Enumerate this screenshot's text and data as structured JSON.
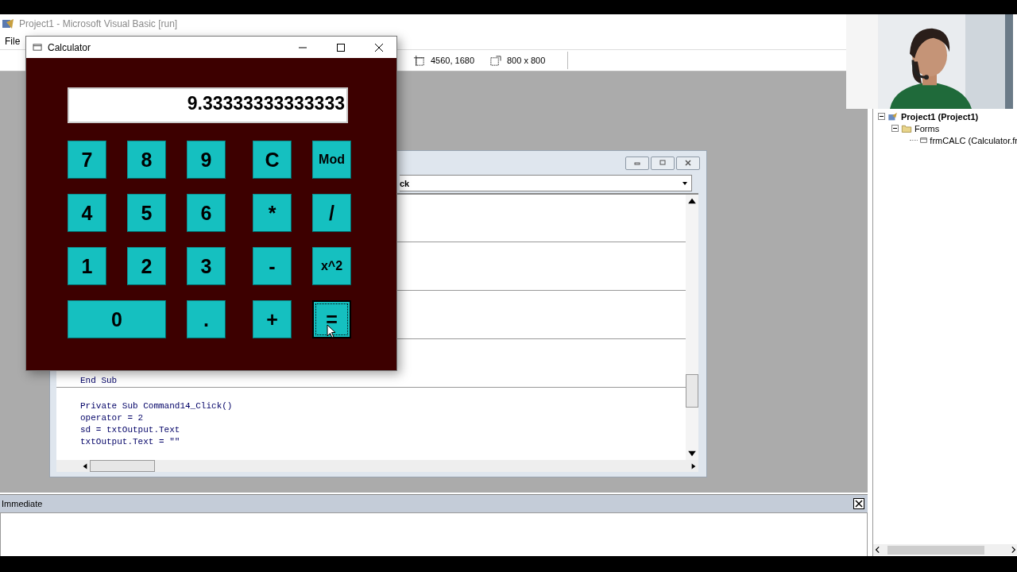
{
  "main_window": {
    "title": "Project1 - Microsoft Visual Basic [run]",
    "menu": [
      "File"
    ],
    "toolbar": {
      "position": "4560, 1680",
      "size": "800 x 800"
    }
  },
  "code_window": {
    "object_combo": "ck",
    "lines": [
      "End Sub",
      "Private Sub Command14_Click()",
      "operator = 2",
      "sd = txtOutput.Text",
      "txtOutput.Text = \"\""
    ]
  },
  "calculator": {
    "title": "Calculator",
    "display": "9.33333333333333",
    "buttons": [
      {
        "label": "7",
        "wide": false,
        "focused": false
      },
      {
        "label": "8",
        "wide": false,
        "focused": false
      },
      {
        "label": "9",
        "wide": false,
        "focused": false
      },
      {
        "label": "C",
        "wide": false,
        "focused": false
      },
      {
        "label": "Mod",
        "wide": false,
        "focused": false
      },
      {
        "label": "4",
        "wide": false,
        "focused": false
      },
      {
        "label": "5",
        "wide": false,
        "focused": false
      },
      {
        "label": "6",
        "wide": false,
        "focused": false
      },
      {
        "label": "*",
        "wide": false,
        "focused": false
      },
      {
        "label": "/",
        "wide": false,
        "focused": false
      },
      {
        "label": "1",
        "wide": false,
        "focused": false
      },
      {
        "label": "2",
        "wide": false,
        "focused": false
      },
      {
        "label": "3",
        "wide": false,
        "focused": false
      },
      {
        "label": "-",
        "wide": false,
        "focused": false
      },
      {
        "label": "x^2",
        "wide": false,
        "focused": false
      },
      {
        "label": "0",
        "wide": true,
        "focused": false
      },
      {
        "label": ".",
        "wide": false,
        "focused": false
      },
      {
        "label": "+",
        "wide": false,
        "focused": false
      },
      {
        "label": "=",
        "wide": false,
        "focused": true
      }
    ]
  },
  "immediate": {
    "title": "Immediate"
  },
  "project_explorer": {
    "tree": [
      {
        "label": "Project1 (Project1)",
        "expanded": true,
        "children": [
          {
            "label": "Forms",
            "expanded": true,
            "children": [
              {
                "label": "frmCALC (Calculator.fr"
              }
            ]
          }
        ]
      }
    ]
  }
}
